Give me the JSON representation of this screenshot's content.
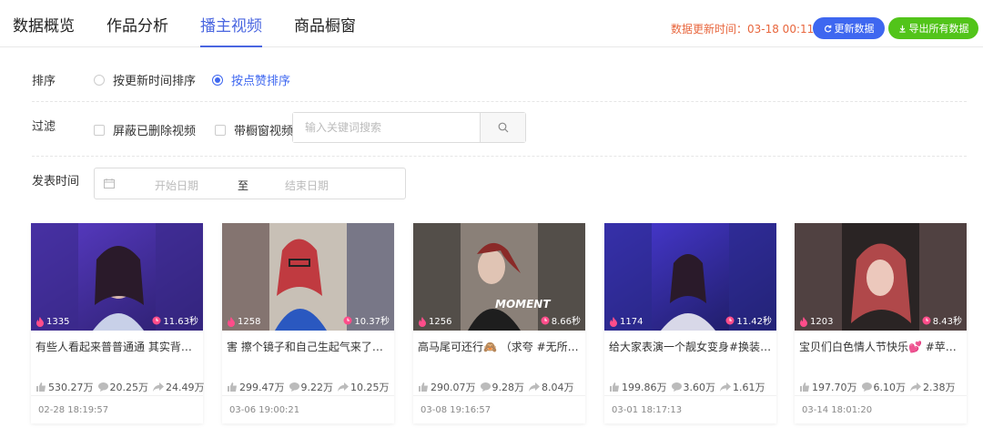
{
  "tabs": [
    "数据概览",
    "作品分析",
    "播主视频",
    "商品橱窗"
  ],
  "header": {
    "update_label": "数据更新时间：03-18 00:11",
    "refresh_label": "更新数据",
    "export_label": "导出所有数据"
  },
  "sort": {
    "label": "排序",
    "option1": "按更新时间排序",
    "option2": "按点赞排序",
    "selected": "option2"
  },
  "filter": {
    "label": "过滤",
    "option1": "屏蔽已删除视频",
    "option2": "带橱窗视频",
    "search_placeholder": "输入关键词搜索"
  },
  "publish": {
    "label": "发表时间",
    "start_placeholder": "开始日期",
    "to": "至",
    "end_placeholder": "结束日期"
  },
  "colors": {
    "accent": "#4a66e0",
    "update_text": "#e8663d",
    "export": "#52c41a",
    "like_icon": "#ff4d8a"
  },
  "videos": [
    {
      "likes": "1335",
      "duration": "11.63秒",
      "title": "有些人看起来普普通通 其实背…",
      "plays": "530.27万",
      "comments": "20.25万",
      "shares": "24.49万",
      "date": "02-28 18:19:57"
    },
    {
      "likes": "1258",
      "duration": "10.37秒",
      "title": "害 擦个镜子和自己生起气来了#…",
      "plays": "299.47万",
      "comments": "9.22万",
      "shares": "10.25万",
      "date": "03-06 19:00:21"
    },
    {
      "likes": "1256",
      "duration": "8.66秒",
      "title": "高马尾可还行🙈 （求夸 #无所…",
      "plays": "290.07万",
      "comments": "9.28万",
      "shares": "8.04万",
      "date": "03-08 19:16:57"
    },
    {
      "likes": "1174",
      "duration": "11.42秒",
      "title": "给大家表演一个靓女变身#换装 …",
      "plays": "199.86万",
      "comments": "3.60万",
      "shares": "1.61万",
      "date": "03-01 18:17:13"
    },
    {
      "likes": "1203",
      "duration": "8.43秒",
      "title": "宝贝们白色情人节快乐💕 #苹…",
      "plays": "197.70万",
      "comments": "6.10万",
      "shares": "2.38万",
      "date": "03-14 18:01:20"
    }
  ],
  "thumb_overlay_text": "MOMENT"
}
